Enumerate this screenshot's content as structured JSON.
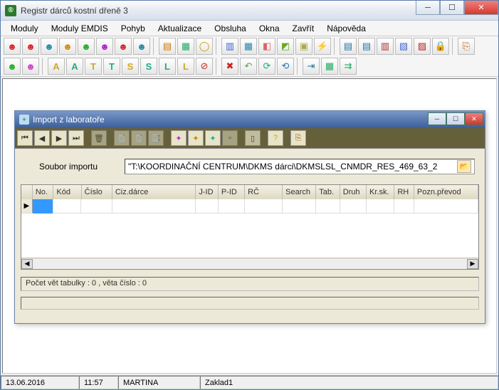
{
  "app": {
    "title": "Registr dárců kostní dřeně 3"
  },
  "menu": {
    "items": [
      "Moduly",
      "Moduly EMDIS",
      "Pohyb",
      "Aktualizace",
      "Obsluha",
      "Okna",
      "Zavřít",
      "Nápověda"
    ]
  },
  "child": {
    "title": "Import z laboratoře",
    "import_label": "Soubor importu",
    "import_path": "\"T:\\KOORDINAČNÍ CENTRUM\\DKMS dárci\\DKMSLSL_CNMDR_RES_469_63_2",
    "columns": [
      "No.",
      "Kód",
      "Číslo",
      "Ciz.dárce",
      "J-ID",
      "P-ID",
      "RČ",
      "Search",
      "Tab.",
      "Druh",
      "Kr.sk.",
      "RH",
      "Pozn.převod"
    ],
    "status": "Počet vět tabulky : 0 , věta číslo : 0"
  },
  "statusbar": {
    "date": "13.06.2016",
    "time": "11:57",
    "user": "MARTINA",
    "db": "Zaklad1"
  }
}
